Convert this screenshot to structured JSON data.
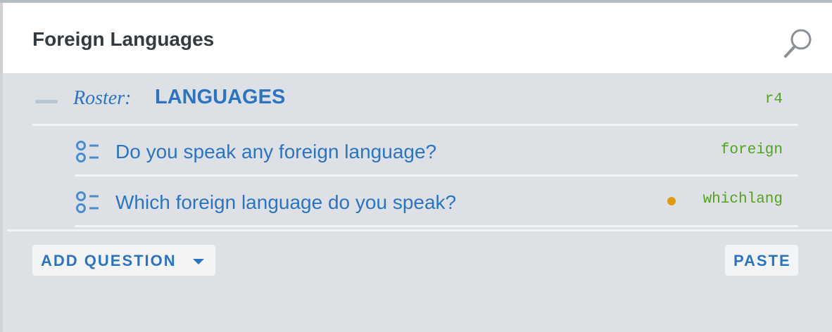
{
  "section": {
    "title": "Foreign Languages",
    "search_icon": "search-icon"
  },
  "roster": {
    "label": "Roster:",
    "name": "LANGUAGES",
    "variable": "r4"
  },
  "questions": [
    {
      "text": "Do you speak any foreign language?",
      "variable": "foreign",
      "icon": "single-choice-list-icon",
      "has_indicator": false
    },
    {
      "text": "Which foreign language do you speak?",
      "variable": "whichlang",
      "icon": "single-choice-list-icon",
      "has_indicator": true,
      "indicator_color": "#e09a12"
    }
  ],
  "actions": {
    "add_question_label": "ADD QUESTION",
    "paste_label": "PASTE"
  },
  "colors": {
    "accent": "#2c74c0",
    "variable": "#51a31d",
    "background": "#dde1e5"
  }
}
